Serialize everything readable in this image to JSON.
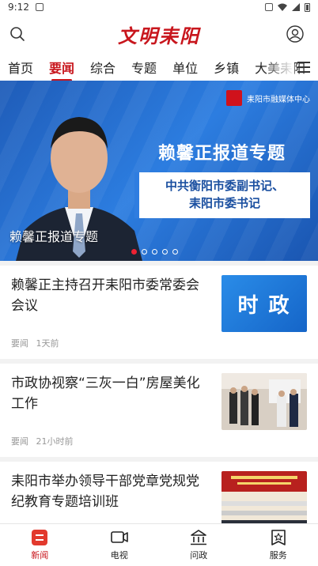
{
  "status": {
    "time": "9:12"
  },
  "header": {
    "logo_text": "文明耒阳"
  },
  "tabs": [
    "首页",
    "要闻",
    "综合",
    "专题",
    "单位",
    "乡镇",
    "大美耒阳"
  ],
  "active_tab": 1,
  "banner": {
    "brand": "耒阳市融媒体中心",
    "headline": "赖馨正报道专题",
    "plate_line1": "中共衡阳市委副书记、",
    "plate_line2": "耒阳市委书记",
    "caption": "赖馨正报道专题",
    "dots": 5,
    "active_dot": 0
  },
  "news": [
    {
      "title": "赖馨正主持召开耒阳市委常委会会议",
      "tag": "要闻",
      "time": "1天前",
      "thumb_text": "时 政"
    },
    {
      "title": "市政协视察“三灰一白”房屋美化工作",
      "tag": "要闻",
      "time": "21小时前",
      "thumb_text": ""
    },
    {
      "title": "耒阳市举办领导干部党章党规党纪教育专题培训班",
      "tag": "",
      "time": "",
      "thumb_text": ""
    }
  ],
  "bottom_nav": [
    {
      "label": "新闻",
      "icon": "news-icon",
      "active": true
    },
    {
      "label": "电视",
      "icon": "tv-icon",
      "active": false
    },
    {
      "label": "问政",
      "icon": "government-icon",
      "active": false
    },
    {
      "label": "服务",
      "icon": "service-icon",
      "active": false
    }
  ],
  "colors": {
    "accent": "#c8161d",
    "banner_blue": "#2c7de0"
  }
}
